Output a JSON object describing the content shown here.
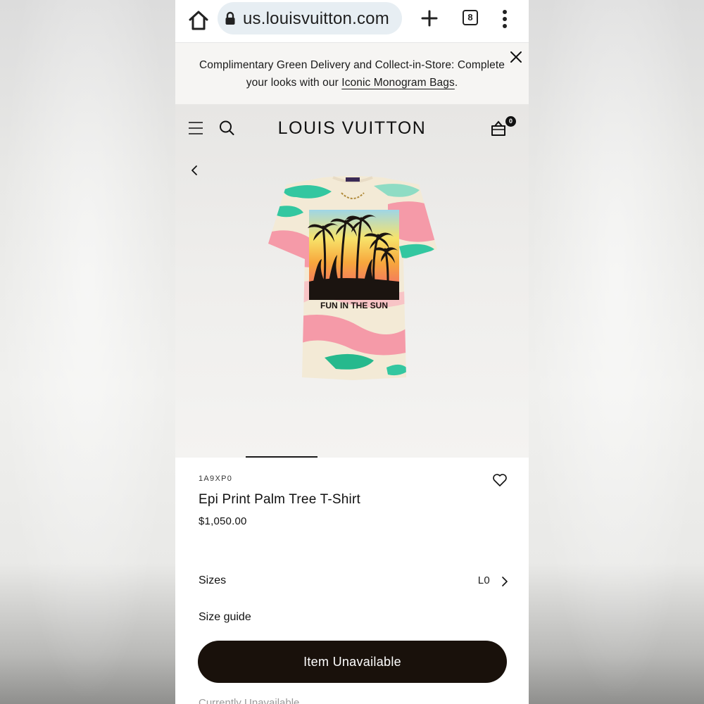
{
  "browser": {
    "url": "us.louisvuitton.com",
    "tab_count": "8"
  },
  "promo": {
    "text_before": "Complimentary Green Delivery and Collect-in-Store: Complete your looks with our ",
    "link": "Iconic Monogram Bags",
    "text_after": "."
  },
  "header": {
    "logo": "LOUIS VUITTON",
    "bag_count": "0"
  },
  "product_image": {
    "print_text": "FUN IN THE SUN"
  },
  "product": {
    "sku": "1A9XP0",
    "name": "Epi Print Palm Tree T-Shirt",
    "price": "$1,050.00"
  },
  "sizes": {
    "label": "Sizes",
    "value": "L0"
  },
  "size_guide": "Size guide",
  "cta": "Item Unavailable",
  "below_fold_text": "Currently Unavailable"
}
